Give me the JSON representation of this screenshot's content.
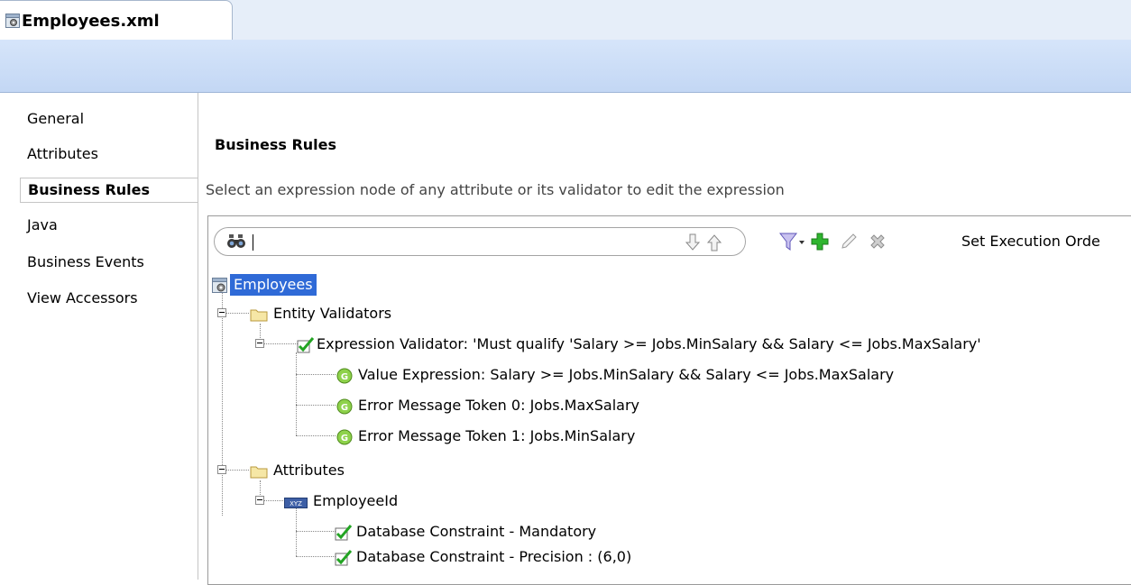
{
  "editor_tab": {
    "title": "Employees.xml",
    "icon": "entity-gear-icon"
  },
  "left_nav": {
    "items": [
      {
        "label": "General",
        "selected": false
      },
      {
        "label": "Attributes",
        "selected": false
      },
      {
        "label": "Business Rules",
        "selected": true
      },
      {
        "label": "Java",
        "selected": false
      },
      {
        "label": "Business Events",
        "selected": false
      },
      {
        "label": "View Accessors",
        "selected": false
      }
    ]
  },
  "main": {
    "title": "Business Rules",
    "description": "Select an expression node of any attribute or its validator to edit the expression"
  },
  "toolbar": {
    "search_value": "",
    "set_execution_order_label": "Set Execution Orde",
    "icons": [
      "binoculars-icon",
      "arrow-down-icon",
      "arrow-up-icon",
      "filter-icon",
      "add-icon",
      "edit-icon",
      "delete-icon"
    ]
  },
  "tree": {
    "root": "Employees",
    "entity_validators": "Entity Validators",
    "expression_validator": "Expression Validator: 'Must qualify 'Salary >= Jobs.MinSalary && Salary <= Jobs.MaxSalary'",
    "value_expression": "Value Expression: Salary >= Jobs.MinSalary && Salary <= Jobs.MaxSalary",
    "error_token_0": "Error Message Token 0: Jobs.MaxSalary",
    "error_token_1": "Error Message Token 1: Jobs.MinSalary",
    "attributes": "Attributes",
    "employee_id": "EmployeeId",
    "db_mandatory": "Database Constraint - Mandatory",
    "db_precision": "Database Constraint - Precision : (6,0)"
  },
  "colors": {
    "selection": "#2f6ad7",
    "tab_strip": "#e6eef9",
    "header_bar": "#c3d7f4"
  }
}
